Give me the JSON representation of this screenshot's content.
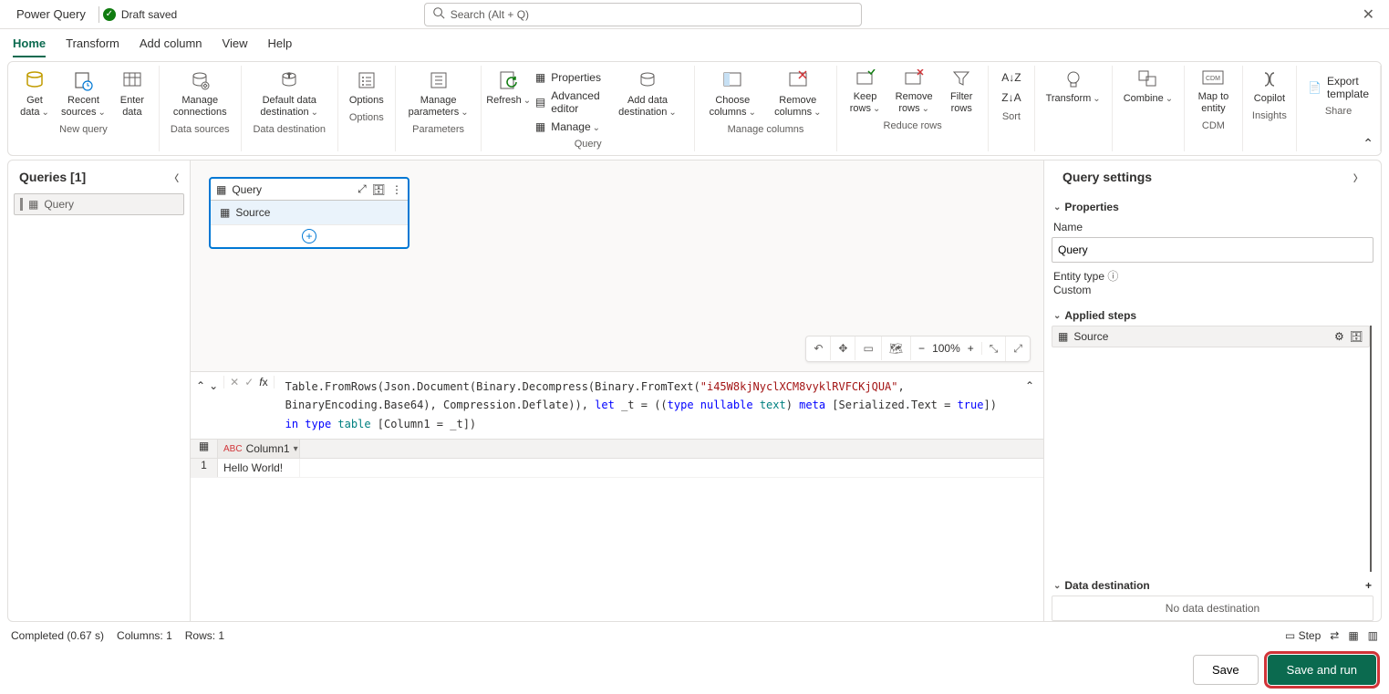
{
  "header": {
    "app_title": "Power Query",
    "draft_label": "Draft saved",
    "search_placeholder": "Search (Alt + Q)"
  },
  "tabs": [
    "Home",
    "Transform",
    "Add column",
    "View",
    "Help"
  ],
  "ribbon": {
    "groups": {
      "new_query": {
        "label": "New query",
        "get_data": "Get data",
        "recent_sources": "Recent sources",
        "enter_data": "Enter data"
      },
      "data_sources": {
        "label": "Data sources",
        "manage_connections": "Manage connections"
      },
      "data_destination": {
        "label": "Data destination",
        "default_dest": "Default data destination"
      },
      "options": {
        "label": "Options",
        "options_btn": "Options"
      },
      "parameters": {
        "label": "Parameters",
        "manage_parameters": "Manage parameters"
      },
      "query": {
        "label": "Query",
        "refresh": "Refresh",
        "properties": "Properties",
        "advanced_editor": "Advanced editor",
        "manage": "Manage",
        "add_data_destination": "Add data destination"
      },
      "manage_columns": {
        "label": "Manage columns",
        "choose_columns": "Choose columns",
        "remove_columns": "Remove columns"
      },
      "reduce_rows": {
        "label": "Reduce rows",
        "keep_rows": "Keep rows",
        "remove_rows": "Remove rows",
        "filter_rows": "Filter rows"
      },
      "sort": {
        "label": "Sort"
      },
      "transform": {
        "label": "",
        "transform_btn": "Transform"
      },
      "combine": {
        "label": "",
        "combine_btn": "Combine"
      },
      "cdm": {
        "label": "CDM",
        "map_to_entity": "Map to entity"
      },
      "insights": {
        "label": "Insights",
        "copilot": "Copilot"
      },
      "share": {
        "label": "Share",
        "export_template": "Export template"
      }
    }
  },
  "queries_pane": {
    "title": "Queries [1]",
    "items": [
      "Query"
    ]
  },
  "diagram": {
    "node_title": "Query",
    "step_label": "Source"
  },
  "view_toolbar": {
    "zoom": "100%"
  },
  "formula": {
    "p1": "Table.FromRows(Json.Document(Binary.Decompress(Binary.FromText(",
    "str": "\"i45W8kjNyclXCM8vyklRVFCKjQUA\"",
    "p2": ", BinaryEncoding.Base64), Compression.Deflate)), ",
    "kw_let": "let",
    "p3": " _t = ((",
    "kw_type1": "type",
    "sp": " ",
    "kw_nullable": "nullable",
    "kw_text": "text",
    "p4": ") ",
    "kw_meta": "meta",
    "p5": " [Serialized.Text = ",
    "kw_true": "true",
    "p6": "]) ",
    "kw_in": "in",
    "kw_type2": "type",
    "kw_table": "table",
    "p7": " [Column1 = _t])"
  },
  "grid": {
    "column": "Column1",
    "row1_idx": "1",
    "row1_val": "Hello World!"
  },
  "settings": {
    "title": "Query settings",
    "properties": "Properties",
    "name_label": "Name",
    "name_value": "Query",
    "entity_type_label": "Entity type",
    "entity_type_value": "Custom",
    "applied_steps": "Applied steps",
    "step_source": "Source",
    "data_destination": "Data destination",
    "no_dest": "No data destination"
  },
  "status": {
    "completed": "Completed (0.67 s)",
    "columns": "Columns: 1",
    "rows": "Rows: 1",
    "step_label": "Step"
  },
  "buttons": {
    "save": "Save",
    "save_run": "Save and run"
  }
}
